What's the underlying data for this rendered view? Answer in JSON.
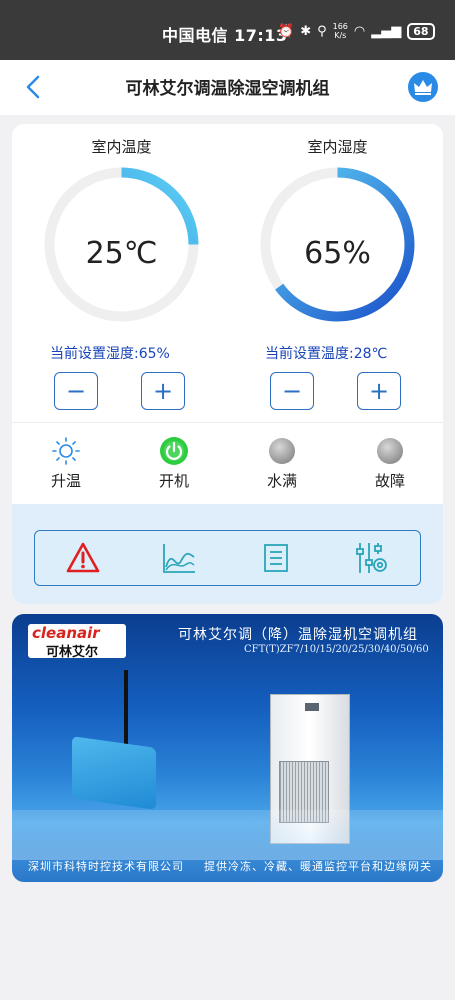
{
  "status_bar": {
    "carrier_time": "中国电信 17:13",
    "network_speed_value": "166",
    "network_speed_unit": "K/s",
    "battery": "68"
  },
  "nav": {
    "title": "可林艾尔调温除湿空调机组",
    "back_icon": "chevron-left-icon",
    "vip_icon": "crown-icon"
  },
  "gauges": [
    {
      "label": "室内温度",
      "value": "25℃",
      "level": 0.25,
      "setting": "当前设置湿度:65%",
      "color": "#2196e8"
    },
    {
      "label": "室内湿度",
      "value": "65%",
      "level": 0.65,
      "setting": "当前设置温度:28℃",
      "color": "#1a5fd0"
    }
  ],
  "stepper": {
    "minus": "−",
    "plus": "+"
  },
  "status_items": [
    {
      "label": "升温",
      "icon": "sun-icon"
    },
    {
      "label": "开机",
      "icon": "power-icon",
      "color": "#2ecc40"
    },
    {
      "label": "水满",
      "icon": "indicator-dot-icon",
      "color": "#a9a9a9"
    },
    {
      "label": "故障",
      "icon": "indicator-dot-icon",
      "color": "#a9a9a9"
    }
  ],
  "tools": [
    {
      "icon": "alarm-warning-icon",
      "color": "#e02020"
    },
    {
      "icon": "line-chart-icon",
      "color": "#2aa6b8"
    },
    {
      "icon": "document-list-icon",
      "color": "#2aa6b8"
    },
    {
      "icon": "settings-sliders-icon",
      "color": "#2aa6b8"
    }
  ],
  "banner": {
    "logo_en": "cleanair",
    "logo_cn": "可林艾尔",
    "title": "可林艾尔调（降）温除湿机空调机组",
    "model": "CFT(T)ZF7/10/15/20/25/30/40/50/60",
    "company": "深圳市科特时控技术有限公司",
    "slogan": "提供冷冻、冷藏、暖通监控平台和边缘网关"
  }
}
